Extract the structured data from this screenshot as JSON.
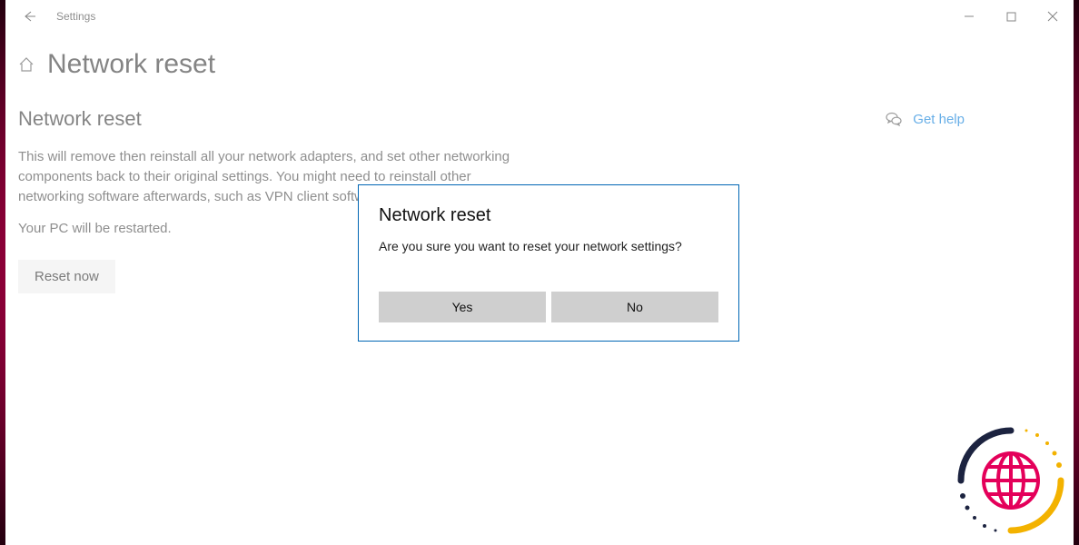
{
  "titlebar": {
    "app_name": "Settings"
  },
  "page": {
    "title": "Network reset",
    "subheading": "Network reset",
    "body": "This will remove then reinstall all your network adapters, and set other networking components back to their original settings. You might need to reinstall other networking software afterwards, such as VPN client software or virtual switches.",
    "restart_notice": "Your PC will be restarted.",
    "reset_button": "Reset now"
  },
  "sidebar": {
    "help_link": "Get help"
  },
  "dialog": {
    "title": "Network reset",
    "message": "Are you sure you want to reset your network settings?",
    "yes": "Yes",
    "no": "No"
  }
}
